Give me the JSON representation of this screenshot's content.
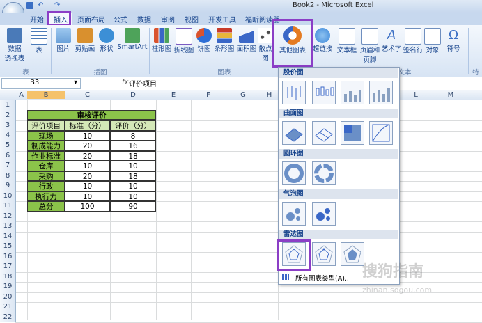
{
  "window": {
    "title": "Book2 - Microsoft Excel"
  },
  "tabs": [
    "开始",
    "插入",
    "页面布局",
    "公式",
    "数据",
    "审阅",
    "视图",
    "开发工具",
    "福昕阅读器"
  ],
  "ribbon": {
    "buttons": [
      {
        "label": "数据\n透视表",
        "color": "#4a7ab8"
      },
      {
        "label": "表",
        "color": "#4a7ab8"
      },
      {
        "label": "图片",
        "color": "#6aa0d8"
      },
      {
        "label": "剪贴画",
        "color": "#d9902e"
      },
      {
        "label": "形状",
        "color": "#3c8fd6"
      },
      {
        "label": "SmartArt",
        "color": "#4ea35a"
      },
      {
        "label": "柱形图",
        "color": "#d9532e"
      },
      {
        "label": "折线图",
        "color": "#7a5cc2"
      },
      {
        "label": "饼图",
        "color": "#2e6fd6"
      },
      {
        "label": "条形图",
        "color": "#c93b2a"
      },
      {
        "label": "面积图",
        "color": "#3a67c7"
      },
      {
        "label": "散点图",
        "color": "#4b4b4b"
      },
      {
        "label": "其他图表",
        "color": "#e47b22"
      },
      {
        "label": "超链接",
        "color": "#3a86d9"
      },
      {
        "label": "文本框",
        "color": "#6f8fbf"
      },
      {
        "label": "页眉和\n页脚",
        "color": "#6f8fbf"
      },
      {
        "label": "艺术字",
        "color": "#3b6fc4"
      },
      {
        "label": "签名行",
        "color": "#6f8fbf"
      },
      {
        "label": "对象",
        "color": "#6f8fbf"
      },
      {
        "label": "符号",
        "color": "#3b6fc4"
      }
    ],
    "groups": [
      "表",
      "插图",
      "图表",
      "文本",
      "特殊"
    ]
  },
  "formula_bar": {
    "name_box": "B3",
    "fx": "fx",
    "content": "评价项目"
  },
  "columns": [
    "A",
    "B",
    "C",
    "D",
    "E",
    "F",
    "G",
    "H",
    "I",
    "J",
    "K",
    "L",
    "M"
  ],
  "rows": [
    "1",
    "2",
    "3",
    "4",
    "5",
    "6",
    "7",
    "8",
    "9",
    "10",
    "11",
    "12",
    "13",
    "14",
    "15",
    "16",
    "17",
    "18",
    "19",
    "20",
    "21",
    "22"
  ],
  "table": {
    "title": "审核评价",
    "headers": [
      "评价项目",
      "标准（分）",
      "评价（分）"
    ],
    "rows": [
      [
        "现场",
        "10",
        "8"
      ],
      [
        "制成能力",
        "20",
        "16"
      ],
      [
        "作业标准",
        "20",
        "18"
      ],
      [
        "仓库",
        "10",
        "10"
      ],
      [
        "采购",
        "20",
        "18"
      ],
      [
        "行政",
        "10",
        "10"
      ],
      [
        "执行力",
        "10",
        "10"
      ]
    ],
    "total": [
      "总分",
      "100",
      "90"
    ]
  },
  "dropdown": {
    "sections": [
      "股价图",
      "曲面图",
      "圆环图",
      "气泡图",
      "雷达图"
    ],
    "all_types": "所有图表类型(A)..."
  },
  "watermark": {
    "text": "搜狗指南",
    "url_text": "zhinan.sogou.com"
  }
}
